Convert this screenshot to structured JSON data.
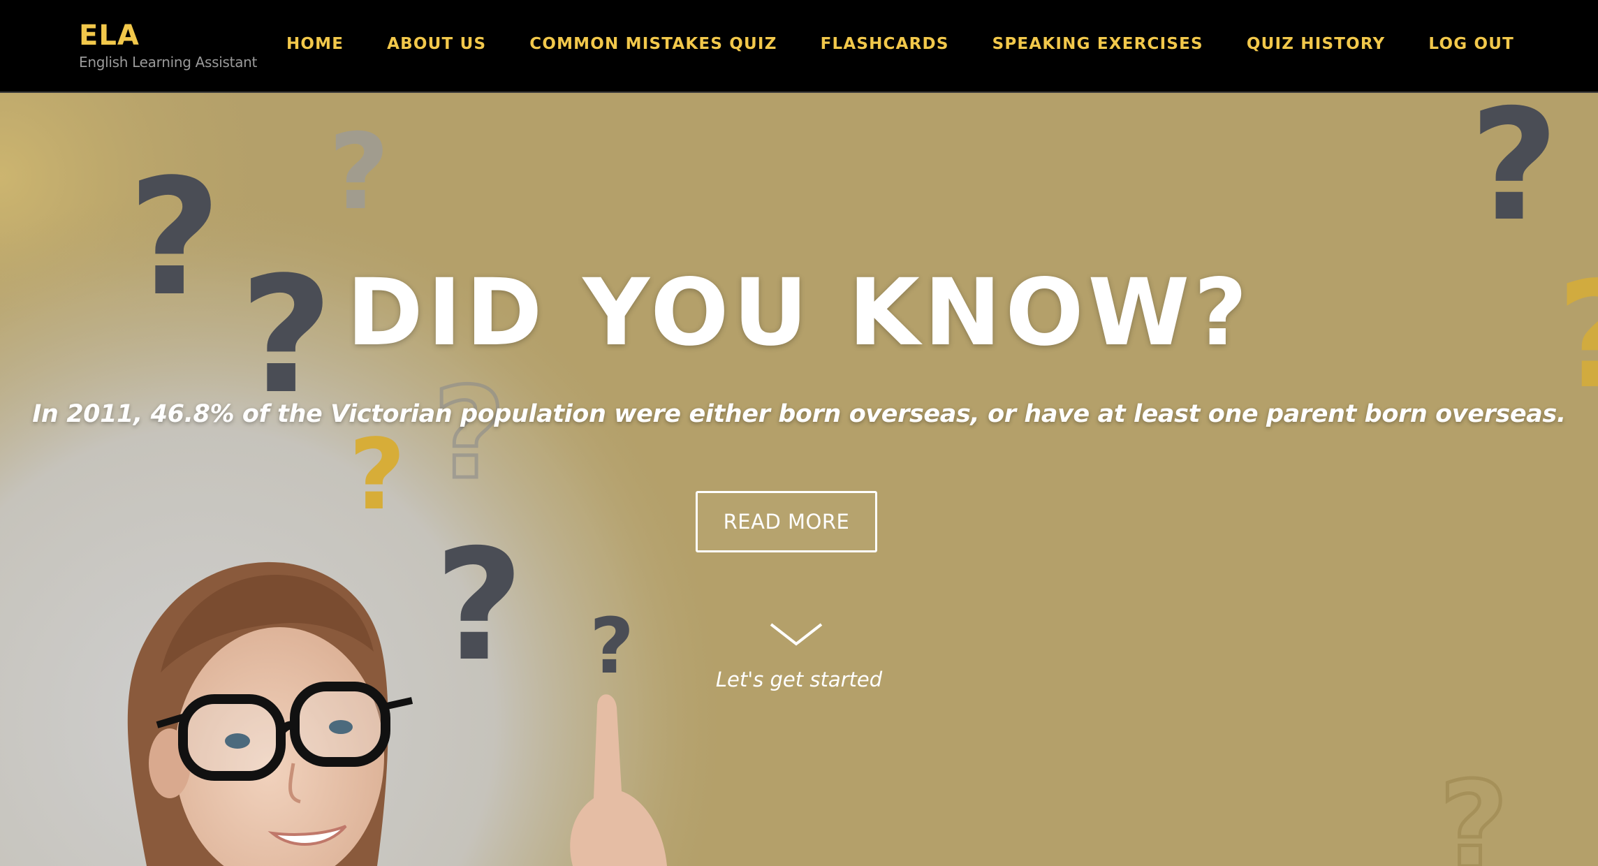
{
  "brand": {
    "name": "ELA",
    "subtitle": "English Learning Assistant"
  },
  "nav": {
    "items": [
      {
        "label": "HOME"
      },
      {
        "label": "ABOUT US"
      },
      {
        "label": "COMMON MISTAKES QUIZ"
      },
      {
        "label": "FLASHCARDS"
      },
      {
        "label": "SPEAKING EXERCISES"
      },
      {
        "label": "QUIZ HISTORY"
      },
      {
        "label": "LOG OUT"
      }
    ]
  },
  "hero": {
    "headline": "DID YOU KNOW?",
    "fact": "In 2011, 46.8% of the Victorian population were either born overseas, or have at least one parent born overseas.",
    "read_more_label": "READ MORE",
    "scroll_icon": "chevron-down-icon",
    "get_started_label": "Let's get started"
  },
  "colors": {
    "nav_background": "#000000",
    "accent": "#f2c84b",
    "hero_background": "#b4a06a",
    "question_mark": "#4a4d55"
  }
}
